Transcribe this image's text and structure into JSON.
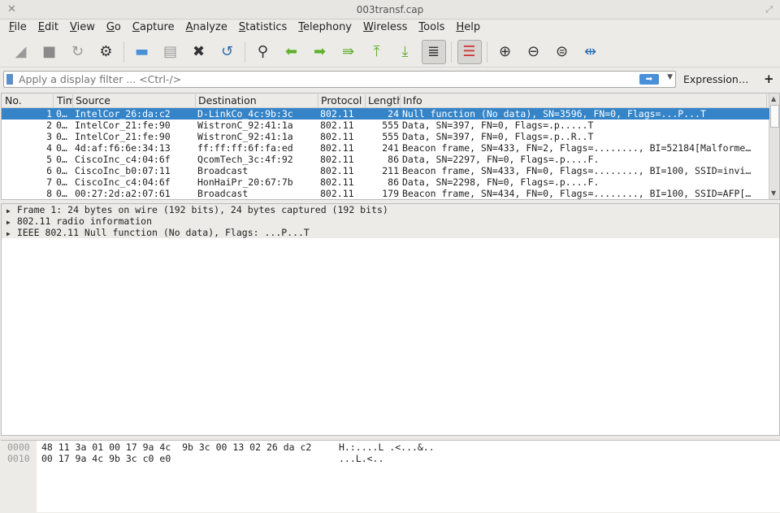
{
  "window": {
    "title": "003transf.cap",
    "close": "✕",
    "maximize": "⤢"
  },
  "menu": [
    "File",
    "Edit",
    "View",
    "Go",
    "Capture",
    "Analyze",
    "Statistics",
    "Telephony",
    "Wireless",
    "Tools",
    "Help"
  ],
  "toolbar": [
    {
      "icon": "shark-fin-start-icon",
      "glyph": "◢",
      "color": "#9a9a9a"
    },
    {
      "icon": "stop-icon",
      "glyph": "■",
      "color": "#8a8a8a"
    },
    {
      "icon": "restart-icon",
      "glyph": "↻",
      "color": "#9a9a9a"
    },
    {
      "icon": "capture-options-gear-icon",
      "glyph": "⚙",
      "color": "#333"
    },
    {
      "sep": true
    },
    {
      "icon": "open-folder-icon",
      "glyph": "▬",
      "color": "#4a90d9"
    },
    {
      "icon": "save-file-icon",
      "glyph": "▤",
      "color": "#999"
    },
    {
      "icon": "close-file-icon",
      "glyph": "✖",
      "color": "#333"
    },
    {
      "icon": "reload-file-icon",
      "glyph": "↺",
      "color": "#2a6db0"
    },
    {
      "sep": true
    },
    {
      "icon": "find-packet-icon",
      "glyph": "⚲",
      "color": "#333"
    },
    {
      "icon": "go-back-icon",
      "glyph": "⬅",
      "color": "#5fb02d"
    },
    {
      "icon": "go-forward-icon",
      "glyph": "➡",
      "color": "#5fb02d"
    },
    {
      "icon": "go-to-packet-icon",
      "glyph": "⇛",
      "color": "#5fb02d"
    },
    {
      "icon": "first-packet-icon",
      "glyph": "⤒",
      "color": "#5fb02d"
    },
    {
      "icon": "last-packet-icon",
      "glyph": "⤓",
      "color": "#5fb02d"
    },
    {
      "icon": "autoscroll-icon",
      "glyph": "≣",
      "color": "#333",
      "active": true
    },
    {
      "sep": true
    },
    {
      "icon": "colorize-icon",
      "glyph": "☰",
      "color": "#c33",
      "active": true
    },
    {
      "sep": true
    },
    {
      "icon": "zoom-in-icon",
      "glyph": "⊕",
      "color": "#333"
    },
    {
      "icon": "zoom-out-icon",
      "glyph": "⊖",
      "color": "#333"
    },
    {
      "icon": "normal-size-icon",
      "glyph": "⊜",
      "color": "#333"
    },
    {
      "icon": "resize-columns-icon",
      "glyph": "⇹",
      "color": "#2a6db0"
    }
  ],
  "filter": {
    "placeholder": "Apply a display filter ... <Ctrl-/>",
    "apply": "➡",
    "dropdown": "▼",
    "expression": "Expression…",
    "add": "+"
  },
  "packet_list": {
    "columns": [
      "No.",
      "Time",
      "Source",
      "Destination",
      "Protocol",
      "Length",
      "Info"
    ],
    "rows": [
      [
        "1",
        "0…",
        "IntelCor_26:da:c2",
        "D-LinkCo_4c:9b:3c",
        "802.11",
        "24",
        "Null function (No data), SN=3596, FN=0, Flags=...P...T"
      ],
      [
        "2",
        "0…",
        "IntelCor_21:fe:90",
        "WistronC_92:41:1a",
        "802.11",
        "555",
        "Data, SN=397, FN=0, Flags=.p.....T"
      ],
      [
        "3",
        "0…",
        "IntelCor_21:fe:90",
        "WistronC_92:41:1a",
        "802.11",
        "555",
        "Data, SN=397, FN=0, Flags=.p..R..T"
      ],
      [
        "4",
        "0…",
        "4d:af:f6:6e:34:13",
        "ff:ff:ff:6f:fa:ed",
        "802.11",
        "241",
        "Beacon frame, SN=433, FN=2, Flags=........, BI=52184[Malforme…"
      ],
      [
        "5",
        "0…",
        "CiscoInc_c4:04:6f",
        "QcomTech_3c:4f:92",
        "802.11",
        "86",
        "Data, SN=2297, FN=0, Flags=.p....F."
      ],
      [
        "6",
        "0…",
        "CiscoInc_b0:07:11",
        "Broadcast",
        "802.11",
        "211",
        "Beacon frame, SN=433, FN=0, Flags=........, BI=100, SSID=invi…"
      ],
      [
        "7",
        "0…",
        "CiscoInc_c4:04:6f",
        "HonHaiPr_20:67:7b",
        "802.11",
        "86",
        "Data, SN=2298, FN=0, Flags=.p....F."
      ],
      [
        "8",
        "0…",
        "00:27:2d:a2:07:61",
        "Broadcast",
        "802.11",
        "179",
        "Beacon frame, SN=434, FN=0, Flags=........, BI=100, SSID=AFP[…"
      ]
    ],
    "selected_row": 1
  },
  "details": [
    "Frame 1: 24 bytes on wire (192 bits), 24 bytes captured (192 bits)",
    "802.11 radio information",
    "IEEE 802.11 Null function (No data), Flags: ...P...T"
  ],
  "hex": [
    {
      "offset": "0000",
      "bytes": "48 11 3a 01 00 17 9a 4c  9b 3c 00 13 02 26 da c2",
      "ascii": "H.:....L .<...&.."
    },
    {
      "offset": "0010",
      "bytes": "00 17 9a 4c 9b 3c c0 e0",
      "ascii": "...L.<.."
    }
  ],
  "colors": {
    "selection": "#3584c8",
    "accent": "#4a90d9"
  }
}
